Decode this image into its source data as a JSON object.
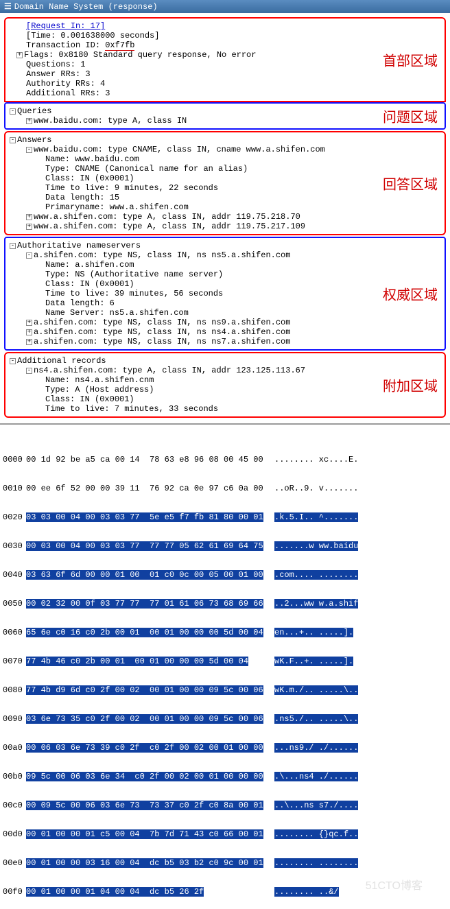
{
  "title": {
    "toggle": "☰",
    "text": "Domain Name System (response)"
  },
  "header": {
    "label_cn": "首部区域",
    "l1": "[Request In: 17]",
    "l2": "[Time: 0.001638000 seconds]",
    "l3a": "Transaction ID: ",
    "l3_txid": "0xf7fb",
    "l4": "Flags: 0x8180 Standard query response, No error",
    "l5": "Questions: 1",
    "l6": "Answer RRs: 3",
    "l7": "Authority RRs: 4",
    "l8": "Additional RRs: 3"
  },
  "queries": {
    "label_cn": "问题区域",
    "title": "Queries",
    "item1": "www.baidu.com: type A, class IN"
  },
  "answers": {
    "label_cn": "回答区域",
    "title": "Answers",
    "r1": "www.baidu.com: type CNAME, class IN, cname www.a.shifen.com",
    "r1_name": "Name: www.baidu.com",
    "r1_type": "Type: CNAME (Canonical name for an alias)",
    "r1_class": "Class: IN (0x0001)",
    "r1_ttl": "Time to live: 9 minutes, 22 seconds",
    "r1_len": "Data length: 15",
    "r1_pname": "Primaryname: www.a.shifen.com",
    "r2": "www.a.shifen.com: type A, class IN, addr 119.75.218.70",
    "r3": "www.a.shifen.com: type A, class IN, addr 119.75.217.109"
  },
  "auth": {
    "label_cn": "权威区域",
    "title": "Authoritative nameservers",
    "r1": "a.shifen.com: type NS, class IN, ns ns5.a.shifen.com",
    "r1_name": "Name: a.shifen.com",
    "r1_type": "Type: NS (Authoritative name server)",
    "r1_class": "Class: IN (0x0001)",
    "r1_ttl": "Time to live: 39 minutes, 56 seconds",
    "r1_len": "Data length: 6",
    "r1_ns": "Name Server: ns5.a.shifen.com",
    "r2": "a.shifen.com: type NS, class IN, ns ns9.a.shifen.com",
    "r3": "a.shifen.com: type NS, class IN, ns ns4.a.shifen.com",
    "r4": "a.shifen.com: type NS, class IN, ns ns7.a.shifen.com"
  },
  "addl": {
    "label_cn": "附加区域",
    "title": "Additional records",
    "r1": "ns4.a.shifen.com: type A, class IN, addr 123.125.113.67",
    "r1_name": "Name: ns4.a.shifen.cnm",
    "r1_type": "Type: A (Host address)",
    "r1_class": "Class: IN (0x0001)",
    "r1_ttl": "Time to live: 7 minutes, 33 seconds"
  },
  "hex": {
    "r0000": {
      "off": "0000",
      "b": "00 1d 92 be a5 ca 00 14  78 63 e8 96 08 00 45 00",
      "a": "........ xc....E."
    },
    "r0010": {
      "off": "0010",
      "b": "00 ee 6f 52 00 00 39 11  76 92 ca 0e 97 c6 0a 00",
      "a": "..oR..9. v......."
    },
    "r0020": {
      "off": "0020",
      "b": "",
      "sel_b": "03 03 00 04 00 03 03 77  5e e5 f7 fb 81 80 00 01",
      "sel_a": ".k.5.I.. ^......."
    },
    "r0030": {
      "off": "0030",
      "sel_b": "00 03 00 04 00 03 03 77  77 77 05 62 61 69 64 75",
      "sel_a": ".......w ww.baidu"
    },
    "r0040": {
      "off": "0040",
      "sel_b": "03 63 6f 6d 00 00 01 00  01 c0 0c 00 05 00 01 00",
      "sel_a": ".com.... ........"
    },
    "r0050": {
      "off": "0050",
      "sel_b": "00 02 32 00 0f 03 77 77  77 01 61 06 73 68 69 66",
      "sel_a": "..2...ww w.a.shif"
    },
    "r0060": {
      "off": "0060",
      "sel_b": "65 6e c0 16 c0 2b 00 01  00 01 00 00 00 5d 00 04",
      "sel_a": "en...+.. .....]."
    },
    "r0070": {
      "off": "0070",
      "sel_b": "77 4b 46 c0 2b 00 01  00 01 00 00 00 5d 00 04",
      "sel_a": "wK.F..+. .....]."
    },
    "r0080": {
      "off": "0080",
      "sel_b": "77 4b d9 6d c0 2f 00 02  00 01 00 00 09 5c 00 06",
      "sel_a": "wK.m./.. .....\\.."
    },
    "r0090": {
      "off": "0090",
      "sel_b": "03 6e 73 35 c0 2f 00 02  00 01 00 00 09 5c 00 06",
      "sel_a": ".ns5./.. .....\\.."
    },
    "r00a0": {
      "off": "00a0",
      "sel_b": "00 06 03 6e 73 39 c0 2f  c0 2f 00 02 00 01 00 00",
      "sel_a": "...ns9./ ./......"
    },
    "r00b0": {
      "off": "00b0",
      "sel_b": "09 5c 00 06 03 6e 34  c0 2f 00 02 00 01 00 00 00",
      "sel_a": ".\\...ns4 ./......"
    },
    "r00c0": {
      "off": "00c0",
      "sel_b": "00 09 5c 00 06 03 6e 73  73 37 c0 2f c0 8a 00 01",
      "sel_a": "..\\...ns s7./...."
    },
    "r00d0": {
      "off": "00d0",
      "sel_b": "00 01 00 00 01 c5 00 04  7b 7d 71 43 c0 66 00 01",
      "sel_a": "........ {}qc.f.."
    },
    "r00e0": {
      "off": "00e0",
      "sel_b": "00 01 00 00 03 16 00 04  dc b5 03 b2 c0 9c 00 01",
      "sel_a": "........ ........"
    },
    "r00f0": {
      "off": "00f0",
      "sel_b": "00 01 00 00 01 04 00 04  dc b5 26 2f",
      "sel_a": "........ ..&/"
    }
  }
}
